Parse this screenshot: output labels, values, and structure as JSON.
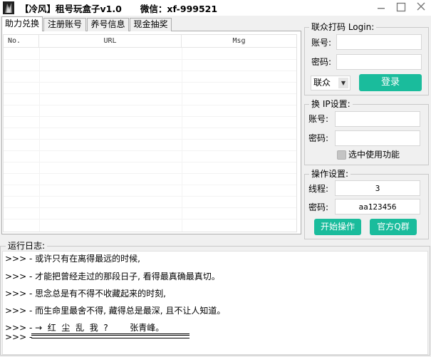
{
  "window": {
    "title": "【冷风】租号玩盒子v1.0      微信：xf-999521",
    "minimize_icon": "minimize-icon",
    "maximize_icon": "maximize-icon",
    "close_icon": "close-icon"
  },
  "tabs": [
    {
      "label": "助力兑换",
      "active": true
    },
    {
      "label": "注册账号",
      "active": false
    },
    {
      "label": "养号信息",
      "active": false
    },
    {
      "label": "现金抽奖",
      "active": false
    }
  ],
  "listview": {
    "columns": [
      "No.",
      "URL",
      "Msg"
    ],
    "rows": []
  },
  "login_group": {
    "title": "联众打码 Login:",
    "account_label": "账号:",
    "account_value": "",
    "password_label": "密码:",
    "password_value": "",
    "service_select": "联众",
    "login_button": "登录"
  },
  "ip_group": {
    "title": "换 IP设置:",
    "account_label": "账号:",
    "account_value": "",
    "password_label": "密码:",
    "password_value": "",
    "checkbox_label": "选中使用功能",
    "checkbox_checked": false
  },
  "ops_group": {
    "title": "操作设置:",
    "thread_label": "线程:",
    "thread_value": "3",
    "password_label": "密码:",
    "password_value": "aa123456",
    "start_button": "开始操作",
    "qq_button": "官方Q群"
  },
  "log": {
    "title": "运行日志:",
    "lines": [
      ">>> - 或许只有在离得最远的时候,",
      ">>> - 才能把曾经走过的那段日子, 看得最真确最真切。",
      ">>> - 思念总是有不得不收藏起来的时刻,",
      ">>> - 而生命里最舍不得, 藏得总是最深, 且不让人知道。",
      ">>> - →  红  尘  乱  我  ?        张青峰。",
      ">>> - "
    ]
  },
  "colors": {
    "accent_button": "#1abc9c",
    "window_bg": "#f0f0f0"
  }
}
